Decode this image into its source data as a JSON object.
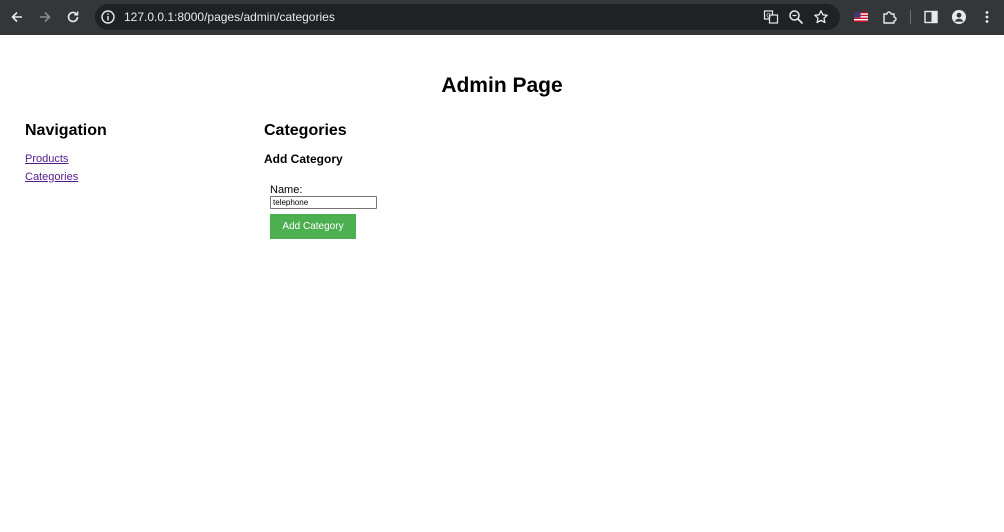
{
  "browser": {
    "url": "127.0.0.1:8000/pages/admin/categories",
    "icons": [
      "back-icon",
      "forward-icon",
      "reload-icon",
      "site-info-icon",
      "translate-icon",
      "zoom-icon",
      "bookmark-star-icon",
      "flag-icon",
      "extensions-icon",
      "side-panel-icon",
      "profile-icon",
      "menu-icon"
    ]
  },
  "page": {
    "title": "Admin Page"
  },
  "navigation": {
    "heading": "Navigation",
    "links": [
      {
        "label": "Products"
      },
      {
        "label": "Categories"
      }
    ]
  },
  "categories": {
    "heading": "Categories",
    "add_heading": "Add Category",
    "name_label": "Name:",
    "name_value": "telephone",
    "submit_label": "Add Category"
  },
  "colors": {
    "chrome_bg": "#35363a",
    "omnibox_bg": "#202124",
    "button_green": "#4caf50",
    "visited_link": "#551a8b"
  }
}
